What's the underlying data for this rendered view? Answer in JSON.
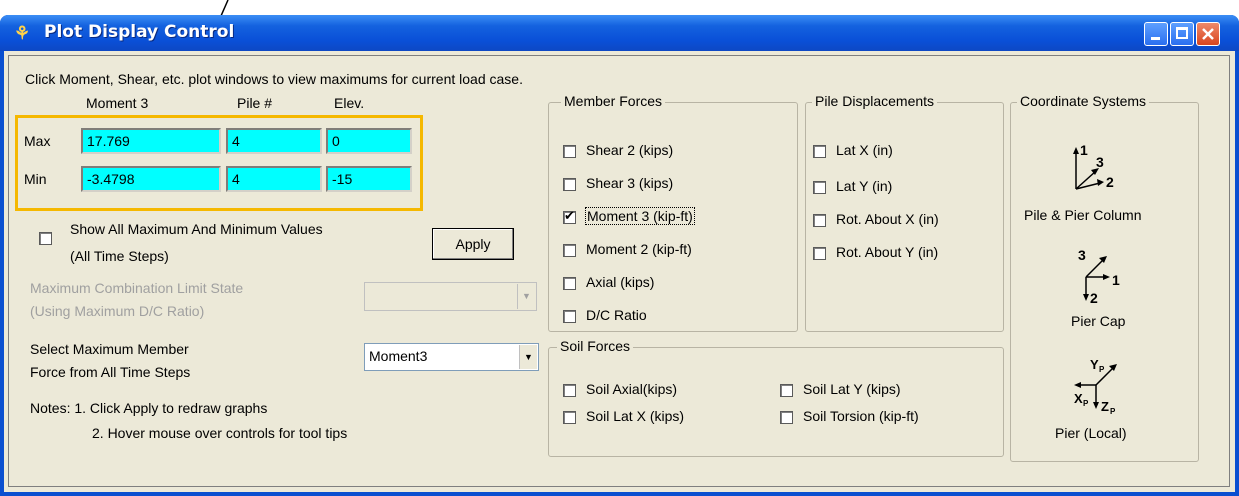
{
  "window": {
    "title": "Plot Display Control",
    "buttons": [
      "minimize",
      "maximize",
      "close"
    ]
  },
  "instructions": "Click Moment, Shear, etc. plot windows to view maximums for current load case.",
  "values": {
    "headers": {
      "force": "Moment 3",
      "pile": "Pile #",
      "elev": "Elev."
    },
    "max": {
      "label": "Max",
      "force": "17.769",
      "pile": "4",
      "elev": "0"
    },
    "min": {
      "label": "Min",
      "force": "-3.4798",
      "pile": "4",
      "elev": "-15"
    },
    "highlight_color": "#f5b800",
    "field_color": "#00ffff"
  },
  "show_all": {
    "line1": "Show All Maximum And Minimum Values",
    "line2": "(All Time Steps)",
    "checked": false
  },
  "apply_label": "Apply",
  "limit_state": {
    "line1": "Maximum Combination Limit State",
    "line2": "(Using Maximum D/C Ratio)",
    "value": "",
    "enabled": false
  },
  "select_max": {
    "line1": "Select Maximum Member",
    "line2": "Force from All Time Steps",
    "value": "Moment3"
  },
  "notes": {
    "line1": "Notes: 1. Click Apply to redraw graphs",
    "line2": "2. Hover mouse over controls for tool tips"
  },
  "member_forces": {
    "label": "Member Forces",
    "items": [
      {
        "label": "Shear 2 (kips)",
        "checked": false
      },
      {
        "label": "Shear 3 (kips)",
        "checked": false
      },
      {
        "label": "Moment 3 (kip-ft)",
        "checked": true
      },
      {
        "label": "Moment 2 (kip-ft)",
        "checked": false
      },
      {
        "label": "Axial (kips)",
        "checked": false
      },
      {
        "label": "D/C Ratio",
        "checked": false
      }
    ]
  },
  "pile_displacements": {
    "label": "Pile Displacements",
    "items": [
      {
        "label": "Lat X (in)",
        "checked": false
      },
      {
        "label": "Lat Y (in)",
        "checked": false
      },
      {
        "label": "Rot. About X (in)",
        "checked": false
      },
      {
        "label": "Rot. About Y (in)",
        "checked": false
      }
    ]
  },
  "soil_forces": {
    "label": "Soil Forces",
    "items": [
      {
        "label": "Soil Axial(kips)",
        "checked": false
      },
      {
        "label": "Soil Lat X (kips)",
        "checked": false
      },
      {
        "label": "Soil Lat Y (kips)",
        "checked": false
      },
      {
        "label": "Soil Torsion (kip-ft)",
        "checked": false
      }
    ]
  },
  "coordinate_systems": {
    "label": "Coordinate Systems",
    "pile_pier": {
      "caption": "Pile & Pier Column",
      "axes": [
        "1",
        "3",
        "2"
      ]
    },
    "pier_cap": {
      "caption": "Pier Cap",
      "axes": [
        "3",
        "1",
        "2"
      ]
    },
    "pier_local": {
      "caption": "Pier (Local)",
      "axes": [
        "Y",
        "P",
        "X",
        "P",
        "Z",
        "P"
      ]
    }
  }
}
